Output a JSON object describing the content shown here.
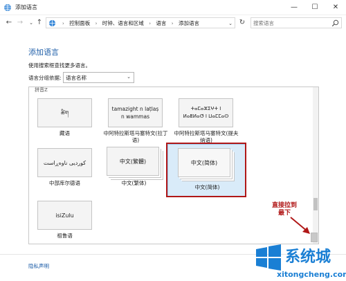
{
  "window": {
    "title": "添加语言"
  },
  "window_controls": {
    "min": "—",
    "max": "☐",
    "close": "✕"
  },
  "nav": {
    "breadcrumbs": [
      "控制面板",
      "时钟、语言和区域",
      "语言",
      "添加语言"
    ],
    "search_placeholder": "搜索语言"
  },
  "main": {
    "title": "添加语言",
    "instruction": "使用搜索框查找更多语言。",
    "group_label": "语言分组依据:",
    "group_value": "语言名称",
    "section_header": "拼音Z"
  },
  "languages": [
    {
      "tile_text": "ཚིག",
      "label": "藏语"
    },
    {
      "tile_text": "tamazight n laṭlaṣ n wammas",
      "label": "中阿特拉斯塔马塞特文(拉丁语)"
    },
    {
      "tile_text": "ⵜⴰⵎⴰⵣⵉⵖⵜ ⵏ ⵍⴰⵟⵍⴰⵚ ⵏ ⵡⴰⵎⵎⴰⵙ",
      "label": "中阿特拉斯塔马塞特文(提夫纳语)"
    },
    {
      "tile_text": "کوردیی ناوەڕاست",
      "label": "中部库尔德语"
    },
    {
      "tile_text": "中文(繁體)",
      "label": "中文(繁体)"
    },
    {
      "tile_text": "中文(简体)",
      "label": "中文(简体)"
    },
    {
      "tile_text": "isiZulu",
      "label": "祖鲁语"
    }
  ],
  "annotation": {
    "line1": "直接拉到",
    "line2": "最下"
  },
  "footer": {
    "privacy": "隐私声明"
  },
  "watermark": {
    "logo_text": "系统城",
    "url": "xitongcheng.com"
  },
  "colors": {
    "accent": "#1e5ea8",
    "annotation_red": "#b01717",
    "selection": "#d9ebf9",
    "watermark": "#1a7fd4"
  }
}
